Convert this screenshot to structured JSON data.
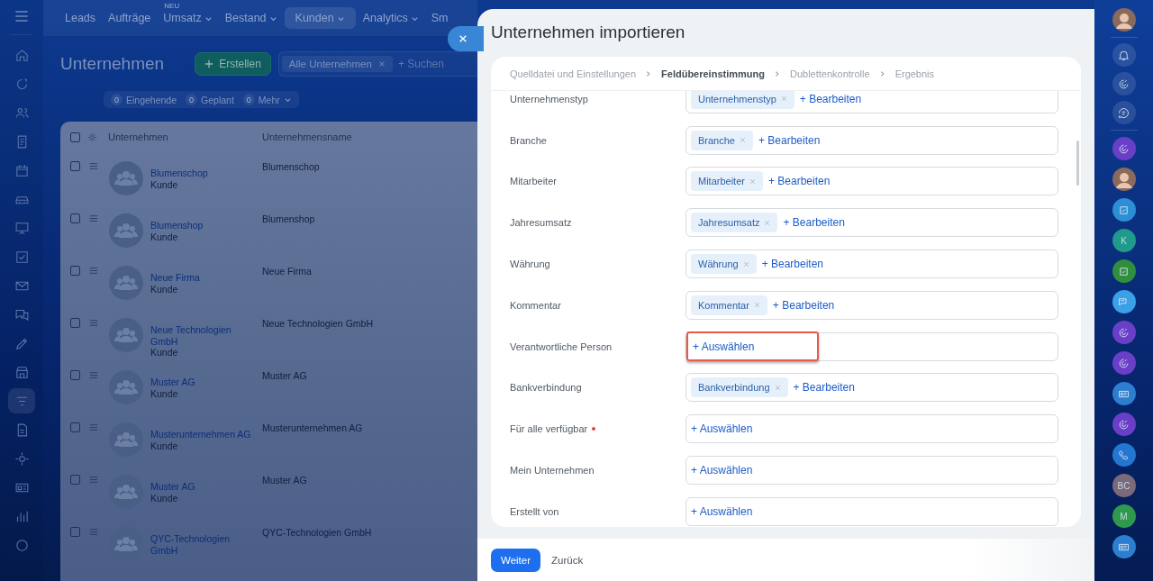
{
  "sidebar": {
    "items": [
      {
        "selected": false
      },
      {
        "selected": false
      },
      {
        "selected": false
      },
      {
        "selected": false
      },
      {
        "selected": false
      },
      {
        "selected": false
      },
      {
        "selected": false
      },
      {
        "selected": false
      },
      {
        "selected": false
      },
      {
        "selected": false
      },
      {
        "selected": false
      },
      {
        "selected": false
      },
      {
        "selected": true
      },
      {
        "selected": false
      },
      {
        "selected": false
      },
      {
        "selected": false
      },
      {
        "selected": false
      },
      {
        "selected": false
      }
    ]
  },
  "top_nav": [
    {
      "label": "Leads",
      "selected": false,
      "dropdown": false
    },
    {
      "label": "Aufträge",
      "selected": false,
      "dropdown": false
    },
    {
      "label": "Umsatz",
      "badge": "NEU",
      "selected": false,
      "dropdown": true
    },
    {
      "label": "Bestand",
      "selected": false,
      "dropdown": true
    },
    {
      "label": "Kunden",
      "selected": true,
      "dropdown": true
    },
    {
      "label": "Analytics",
      "selected": false,
      "dropdown": true
    },
    {
      "label": "Sm",
      "selected": false,
      "dropdown": false
    }
  ],
  "page": {
    "title": "Unternehmen",
    "create_button": "Erstellen",
    "filter_chip": "Alle Unternehmen",
    "search": {
      "placeholder": "+ Suchen"
    },
    "counters": [
      {
        "count": "0",
        "label": "Eingehende",
        "dropdown": false
      },
      {
        "count": "0",
        "label": "Geplant",
        "dropdown": false
      },
      {
        "count": "0",
        "label": "Mehr",
        "dropdown": true
      }
    ]
  },
  "table": {
    "columns": [
      "Unternehmen",
      "Unternehmensname"
    ],
    "select_all": {
      "checked": false
    },
    "rows": [
      {
        "checked": false,
        "name": "Blumenschop",
        "type": "Kunde",
        "company_name": "Blumenschop"
      },
      {
        "checked": false,
        "name": "Blumenshop",
        "type": "Kunde",
        "company_name": "Blumenshop"
      },
      {
        "checked": false,
        "name": "Neue Firma",
        "type": "Kunde",
        "company_name": "Neue Firma"
      },
      {
        "checked": false,
        "name": "Neue Technologien GmbH",
        "type": "Kunde",
        "company_name": "Neue Technologien GmbH"
      },
      {
        "checked": false,
        "name": "Muster AG",
        "type": "Kunde",
        "company_name": "Muster AG"
      },
      {
        "checked": false,
        "name": "Musterunternehmen AG",
        "type": "Kunde",
        "company_name": "Musterunternehmen AG"
      },
      {
        "checked": false,
        "name": "Muster AG",
        "type": "Kunde",
        "company_name": "Muster AG"
      },
      {
        "checked": false,
        "name": "QYC-Technologien GmbH",
        "company_name": "QYC-Technologien GmbH"
      }
    ]
  },
  "right_bar": [
    {
      "kind": "avatar"
    },
    {
      "kind": "bell"
    },
    {
      "kind": "swirl"
    },
    {
      "kind": "messages"
    },
    {
      "kind": "swirl",
      "color": "#6a3fc8"
    },
    {
      "kind": "avatar"
    },
    {
      "kind": "check",
      "color": "#2c8fd6"
    },
    {
      "kind": "initials",
      "text": "K",
      "color": "#1f9a8c"
    },
    {
      "kind": "check",
      "color": "#2f8f3e"
    },
    {
      "kind": "chat",
      "color": "#3aa0e8"
    },
    {
      "kind": "swirl",
      "color": "#6a3fc8"
    },
    {
      "kind": "swirl",
      "color": "#6a3fc8"
    },
    {
      "kind": "contact",
      "color": "#2c7fd0"
    },
    {
      "kind": "swirl",
      "color": "#6a3fc8"
    },
    {
      "kind": "phone",
      "color": "#2377d0"
    },
    {
      "kind": "initials",
      "text": "BC",
      "color": "#7a6a7a"
    },
    {
      "kind": "initials",
      "text": "M",
      "color": "#2f9a4e"
    },
    {
      "kind": "contact",
      "color": "#2c7fd0"
    }
  ],
  "dialog": {
    "title": "Unternehmen importieren",
    "steps": [
      {
        "label": "Quelldatei und Einstellungen",
        "selected": false
      },
      {
        "label": "Feldübereinstimmung",
        "selected": true
      },
      {
        "label": "Dublettenkontrolle",
        "selected": false
      },
      {
        "label": "Ergebnis",
        "selected": false
      }
    ],
    "fields": [
      {
        "label": "Unternehmenstyp",
        "required": false,
        "tags": [
          "Unternehmenstyp"
        ],
        "action": "+ Bearbeiten",
        "highlighted": false
      },
      {
        "label": "Branche",
        "required": false,
        "tags": [
          "Branche"
        ],
        "action": "+ Bearbeiten",
        "highlighted": false
      },
      {
        "label": "Mitarbeiter",
        "required": false,
        "tags": [
          "Mitarbeiter"
        ],
        "action": "+ Bearbeiten",
        "highlighted": false
      },
      {
        "label": "Jahresumsatz",
        "required": false,
        "tags": [
          "Jahresumsatz"
        ],
        "action": "+ Bearbeiten",
        "highlighted": false
      },
      {
        "label": "Währung",
        "required": false,
        "tags": [
          "Währung"
        ],
        "action": "+ Bearbeiten",
        "highlighted": false
      },
      {
        "label": "Kommentar",
        "required": false,
        "tags": [
          "Kommentar"
        ],
        "action": "+ Bearbeiten",
        "highlighted": false
      },
      {
        "label": "Verantwortliche Person",
        "required": false,
        "action": "+ Auswählen",
        "highlighted": true
      },
      {
        "label": "Bankverbindung",
        "required": false,
        "tags": [
          "Bankverbindung"
        ],
        "action": "+ Bearbeiten",
        "highlighted": false
      },
      {
        "label": "Für alle verfügbar",
        "required": true,
        "action": "+ Auswählen",
        "highlighted": false
      },
      {
        "label": "Mein Unternehmen",
        "required": false,
        "action": "+ Auswählen",
        "highlighted": false
      },
      {
        "label": "Erstellt von",
        "required": false,
        "action": "+ Auswählen",
        "highlighted": false
      }
    ],
    "buttons": {
      "primary": "Weiter",
      "secondary": "Zurück"
    }
  }
}
